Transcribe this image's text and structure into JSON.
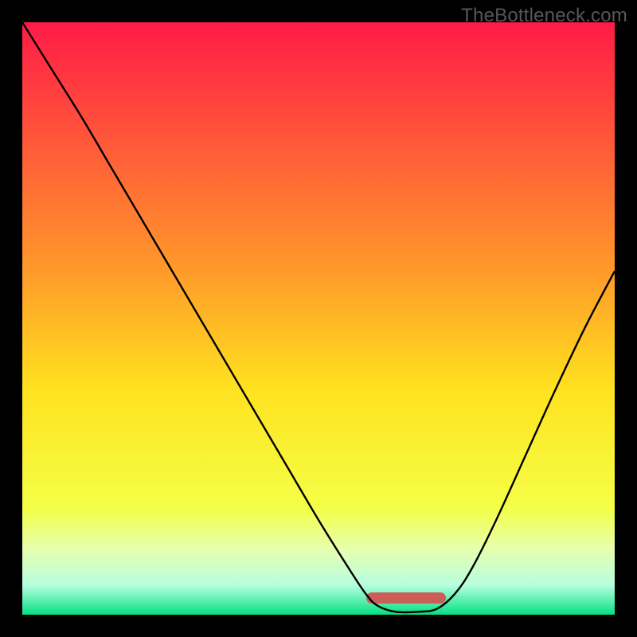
{
  "watermark": "TheBottleneck.com",
  "chart_data": {
    "type": "line",
    "title": "",
    "xlabel": "",
    "ylabel": "",
    "xlim": [
      0,
      100
    ],
    "ylim": [
      0,
      100
    ],
    "gradient_stops": [
      {
        "pct": 0,
        "color": "#ff1b47"
      },
      {
        "pct": 42,
        "color": "#ff9a2a"
      },
      {
        "pct": 62,
        "color": "#ffe21f"
      },
      {
        "pct": 82,
        "color": "#f4ff47"
      },
      {
        "pct": 89,
        "color": "#e6ffb0"
      },
      {
        "pct": 95,
        "color": "#b6ffdf"
      },
      {
        "pct": 100,
        "color": "#06e082"
      }
    ],
    "series": [
      {
        "name": "bottleneck-curve",
        "color": "#000000",
        "points": [
          {
            "x": 0.0,
            "y": 100.0
          },
          {
            "x": 5.0,
            "y": 92.0
          },
          {
            "x": 10.0,
            "y": 84.0
          },
          {
            "x": 15.0,
            "y": 75.5
          },
          {
            "x": 20.0,
            "y": 67.0
          },
          {
            "x": 25.0,
            "y": 58.5
          },
          {
            "x": 30.0,
            "y": 50.0
          },
          {
            "x": 35.0,
            "y": 41.5
          },
          {
            "x": 40.0,
            "y": 33.0
          },
          {
            "x": 45.0,
            "y": 24.5
          },
          {
            "x": 50.0,
            "y": 16.0
          },
          {
            "x": 55.0,
            "y": 8.0
          },
          {
            "x": 58.0,
            "y": 3.5
          },
          {
            "x": 60.0,
            "y": 1.5
          },
          {
            "x": 63.0,
            "y": 0.5
          },
          {
            "x": 67.0,
            "y": 0.5
          },
          {
            "x": 70.0,
            "y": 1.0
          },
          {
            "x": 73.0,
            "y": 3.5
          },
          {
            "x": 76.0,
            "y": 8.0
          },
          {
            "x": 80.0,
            "y": 16.0
          },
          {
            "x": 85.0,
            "y": 27.0
          },
          {
            "x": 90.0,
            "y": 38.0
          },
          {
            "x": 95.0,
            "y": 48.5
          },
          {
            "x": 100.0,
            "y": 58.0
          }
        ]
      }
    ],
    "marker": {
      "name": "optimal-range",
      "color": "#cd5d57",
      "x_start": 58.0,
      "x_end": 71.5,
      "thickness_pct": 1.9,
      "y_center": 2.8
    }
  }
}
